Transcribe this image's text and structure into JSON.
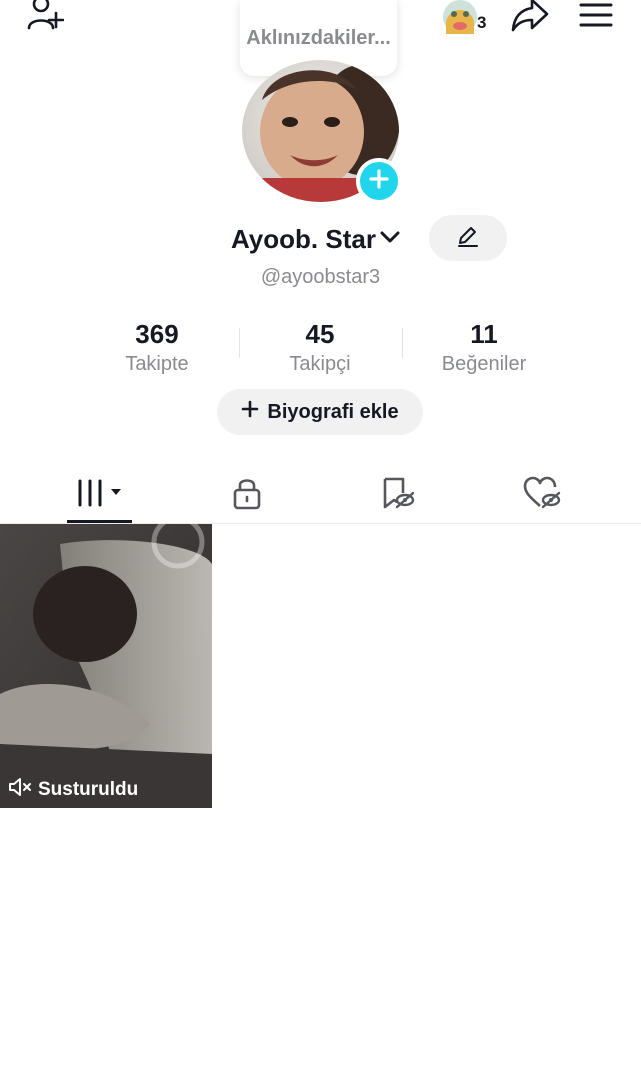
{
  "header": {
    "add_friend_icon": "person-plus-icon",
    "badge_count": "3",
    "share_icon": "share-arrow-icon",
    "menu_icon": "hamburger-menu-icon"
  },
  "bubble": {
    "text": "Aklınızdakiler..."
  },
  "profile": {
    "display_name": "Ayoob. Star",
    "handle": "@ayoobstar3"
  },
  "stats": [
    {
      "value": "369",
      "label": "Takipte"
    },
    {
      "value": "45",
      "label": "Takipçi"
    },
    {
      "value": "11",
      "label": "Beğeniler"
    }
  ],
  "bio_button": {
    "label": "Biyografi ekle"
  },
  "tabs": [
    {
      "name": "videos",
      "icon": "grid-icon",
      "active": true
    },
    {
      "name": "private",
      "icon": "lock-icon"
    },
    {
      "name": "saved",
      "icon": "bookmark-hidden-icon"
    },
    {
      "name": "liked",
      "icon": "heart-hidden-icon"
    }
  ],
  "videos": [
    {
      "status": "Susturuldu"
    }
  ],
  "colors": {
    "accent": "#20d5ec",
    "text": "#161823",
    "muted": "#8a8b91"
  }
}
